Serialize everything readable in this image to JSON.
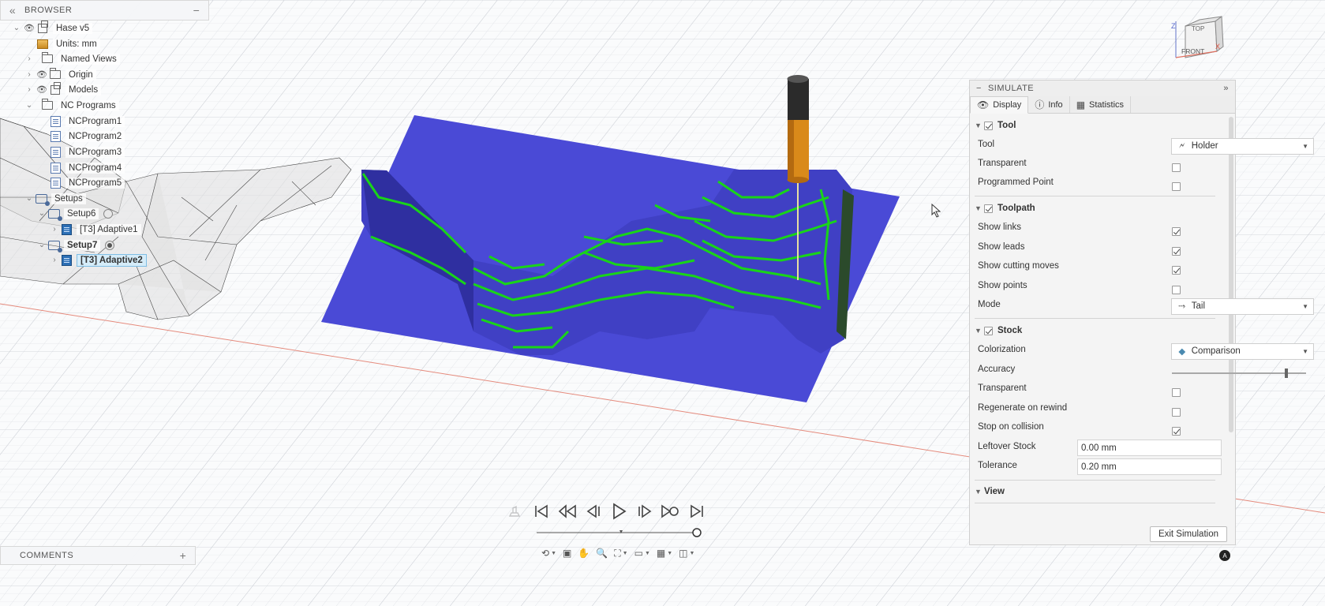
{
  "browser": {
    "title": "BROWSER",
    "collapse_glyph": "«",
    "minimize_glyph": "−",
    "items": [
      {
        "label": "Hase v5",
        "icon": "component-icon"
      },
      {
        "label": "Units: mm",
        "icon": "units-icon"
      },
      {
        "label": "Named Views",
        "icon": "folder-icon"
      },
      {
        "label": "Origin",
        "icon": "folder-icon"
      },
      {
        "label": "Models",
        "icon": "component-icon"
      },
      {
        "label": "NC Programs",
        "icon": "folder-icon"
      },
      {
        "label": "NCProgram1",
        "icon": "nc-program-icon"
      },
      {
        "label": "NCProgram2",
        "icon": "nc-program-icon"
      },
      {
        "label": "NCProgram3",
        "icon": "nc-program-icon"
      },
      {
        "label": "NCProgram4",
        "icon": "nc-program-icon"
      },
      {
        "label": "NCProgram5",
        "icon": "nc-program-icon"
      },
      {
        "label": "Setups",
        "icon": "setup-icon"
      },
      {
        "label": "Setup6",
        "icon": "setup-icon"
      },
      {
        "label": "[T3] Adaptive1",
        "icon": "operation-icon"
      },
      {
        "label": "Setup7",
        "icon": "setup-icon"
      },
      {
        "label": "[T3] Adaptive2",
        "icon": "operation-icon"
      }
    ]
  },
  "comments": {
    "title": "COMMENTS",
    "add_glyph": "+"
  },
  "viewcube": {
    "top": "TOP",
    "front": "FRONT",
    "z": "Z",
    "x": "X"
  },
  "simulate": {
    "title": "SIMULATE",
    "tabs": [
      {
        "label": "Display",
        "icon": "eye-icon"
      },
      {
        "label": "Info",
        "icon": "info-icon"
      },
      {
        "label": "Statistics",
        "icon": "statistics-icon"
      }
    ],
    "sections": {
      "tool": {
        "title": "Tool",
        "enabled": true,
        "tool_label": "Tool",
        "tool_value": "Holder",
        "transparent_label": "Transparent",
        "transparent": false,
        "programmed_point_label": "Programmed Point",
        "programmed_point": false
      },
      "toolpath": {
        "title": "Toolpath",
        "enabled": true,
        "show_links_label": "Show links",
        "show_links": true,
        "show_leads_label": "Show leads",
        "show_leads": true,
        "show_cutting_label": "Show cutting moves",
        "show_cutting": true,
        "show_points_label": "Show points",
        "show_points": false,
        "mode_label": "Mode",
        "mode_value": "Tail"
      },
      "stock": {
        "title": "Stock",
        "enabled": true,
        "colorization_label": "Colorization",
        "colorization_value": "Comparison",
        "accuracy_label": "Accuracy",
        "accuracy": 0.85,
        "transparent_label": "Transparent",
        "transparent": false,
        "regenerate_label": "Regenerate on rewind",
        "regenerate": false,
        "stop_collision_label": "Stop on collision",
        "stop_collision": true,
        "leftover_label": "Leftover Stock",
        "leftover_value": "0.00 mm",
        "tolerance_label": "Tolerance",
        "tolerance_value": "0.20 mm"
      },
      "view": {
        "title": "View"
      }
    },
    "exit_label": "Exit Simulation"
  },
  "playback": {
    "progress": 0.97
  },
  "colors": {
    "stock_blue": "#4a4ad6",
    "toolpath_green": "#19d419",
    "tool_shank": "#d98a1a",
    "holder_dark": "#2b2b2b",
    "selection_blue": "#d5ecf9",
    "x_axis_red": "#e07060"
  }
}
